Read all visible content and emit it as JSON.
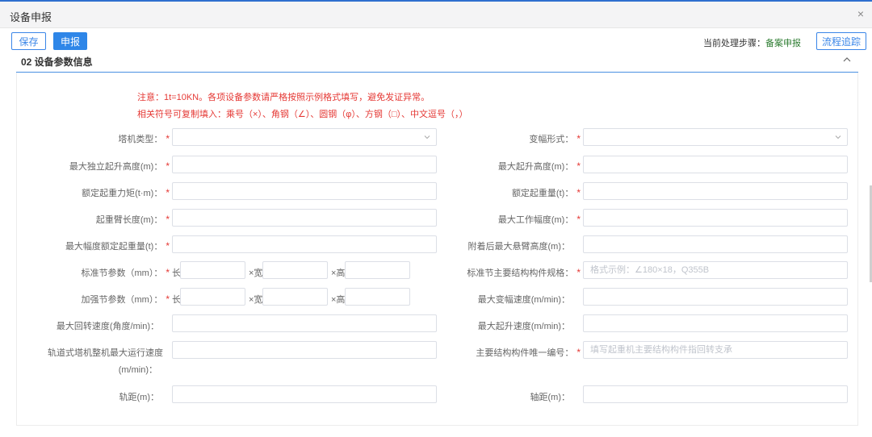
{
  "window": {
    "title": "设备申报",
    "close_symbol": "×"
  },
  "toolbar": {
    "save_label": "保存",
    "submit_label": "申报",
    "step_prefix": "当前处理步骤：",
    "step_value": "备案申报",
    "trace_label": "流程追踪"
  },
  "section": {
    "title": "02   设备参数信息"
  },
  "notes": {
    "line1": "注意：1t=10KN。各项设备参数请严格按照示例格式填写，避免发证异常。",
    "line2": "相关符号可复制填入：乘号（×）、角钢（∠）、圆钢（φ）、方钢（□）、中文逗号（，）"
  },
  "fields": {
    "tower_type": "塔机类型：",
    "luffing_form": "变幅形式：",
    "max_free_height": "最大独立起升高度(m)：",
    "max_lift_height": "最大起升高度(m)：",
    "rated_moment": "额定起重力矩(t·m)：",
    "rated_load": "额定起重量(t)：",
    "jib_length": "起重臂长度(m)：",
    "max_radius": "最大工作幅度(m)：",
    "max_radius_load": "最大幅度额定起重量(t)：",
    "cantilever_height": "附着后最大悬臂高度(m)：",
    "std_section": "标准节参数（mm）：",
    "std_member_spec": "标准节主要结构构件规格：",
    "std_member_placeholder": "格式示例：∠180×18，Q355B",
    "reinforced_section": "加强节参数（mm）：",
    "max_luffing_speed": "最大变幅速度(m/min)：",
    "max_slew_speed": "最大回转速度(角度/min)：",
    "max_hoist_speed": "最大起升速度(m/min)：",
    "rail_speed_line1": "轨道式塔机整机最大运行速度",
    "rail_speed_line2": "(m/min)：",
    "main_member_id": "主要结构构件唯一编号：",
    "main_member_placeholder": "填写起重机主要结构构件指回转支承",
    "gauge": "轨距(m)：",
    "wheelbase": "轴距(m)："
  },
  "dims": {
    "length": "长",
    "width": "×宽",
    "height": "×高"
  },
  "required_mark": "*",
  "colors": {
    "primary": "#2e86e8",
    "required": "#e53935",
    "step_value": "#2e7d32"
  }
}
